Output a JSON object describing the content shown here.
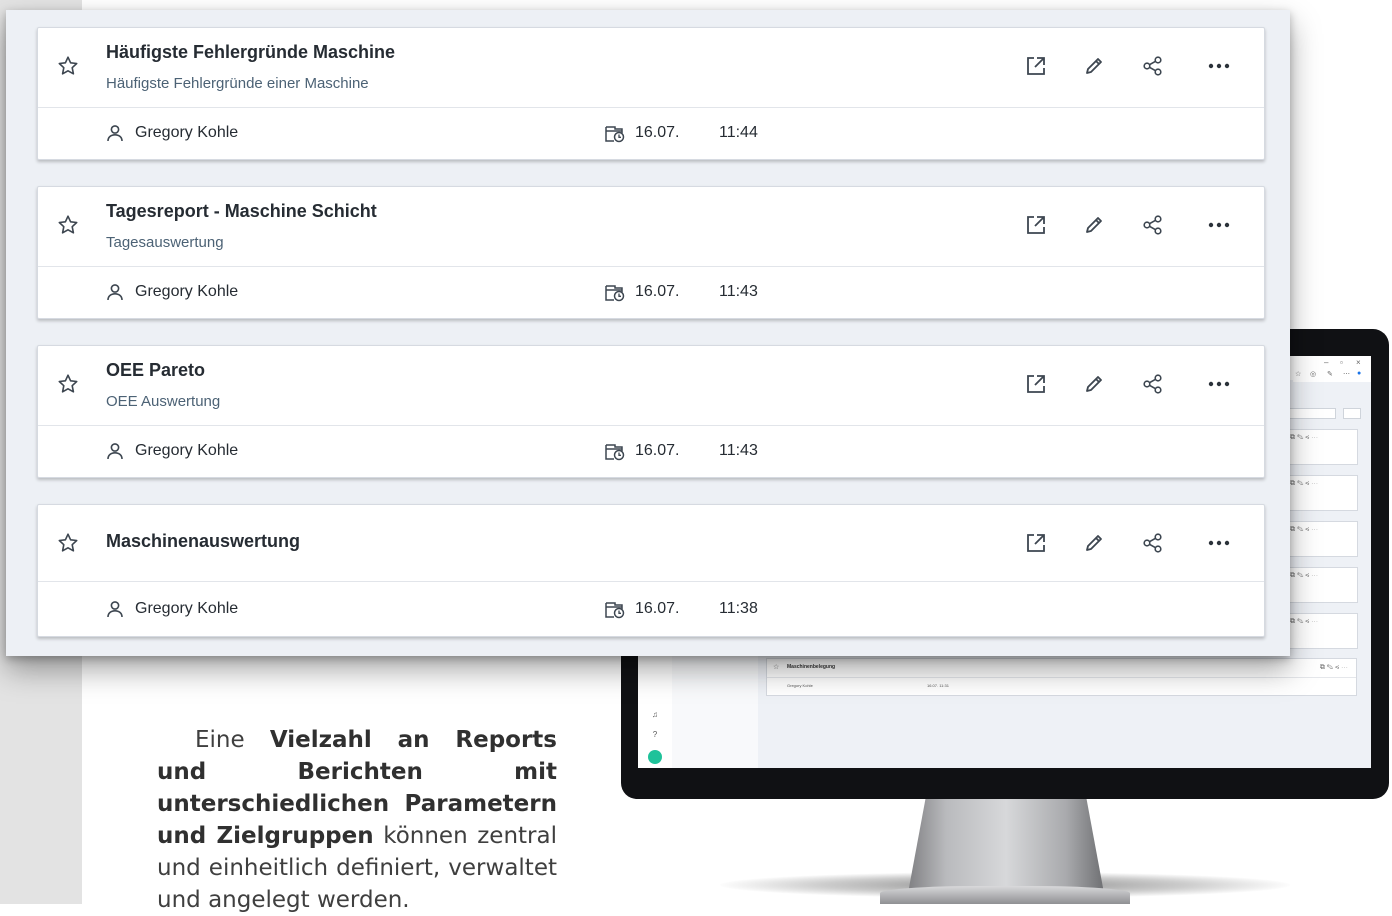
{
  "reports": [
    {
      "title": "Häufigste Fehlergründe Maschine",
      "subtitle": "Häufigste Fehlergründe einer Maschine",
      "author": "Gregory Kohle",
      "date": "16.07.",
      "time": "11:44"
    },
    {
      "title": "Tagesreport - Maschine Schicht",
      "subtitle": "Tagesauswertung",
      "author": "Gregory Kohle",
      "date": "16.07.",
      "time": "11:43"
    },
    {
      "title": "OEE Pareto",
      "subtitle": "OEE Auswertung",
      "author": "Gregory Kohle",
      "date": "16.07.",
      "time": "11:43"
    },
    {
      "title": "Maschinenauswertung",
      "subtitle": "",
      "author": "Gregory Kohle",
      "date": "16.07.",
      "time": "11:38"
    }
  ],
  "icons": {
    "favorite": "star-outline-icon",
    "open": "open-external-icon",
    "edit": "pencil-icon",
    "share": "share-icon",
    "more": "more-horizontal-icon",
    "author": "person-icon",
    "modified": "calendar-clock-icon"
  },
  "monitor_preview": {
    "card_title": "Maschinenbelegung",
    "card_author": "Gregory Kohle",
    "card_date": "16.07.",
    "card_time": "11:31"
  },
  "description": {
    "lead": "Eine ",
    "bold": "Vielzahl an Reports und Berichten mit unterschiedlichen Parametern und Zielgruppen",
    "rest": " können zentral und einheitlich definiert, verwaltet und angelegt werden."
  },
  "colors": {
    "window_bg": "#edf0f5",
    "card_bg": "#ffffff",
    "title_text": "#262c33",
    "subtitle_text": "#4c6275",
    "monitor_accent": "#1fc29a"
  }
}
